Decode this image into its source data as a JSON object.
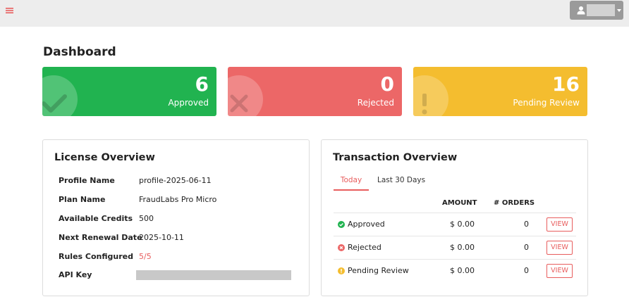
{
  "topbar": {
    "menu_icon": "hamburger-icon",
    "user_icon": "user-icon",
    "accent": "#e85d5d"
  },
  "page": {
    "title": "Dashboard"
  },
  "stats": [
    {
      "value": "6",
      "label": "Approved",
      "icon": "check-icon",
      "color": "#21b350"
    },
    {
      "value": "0",
      "label": "Rejected",
      "icon": "cross-icon",
      "color": "#ec6767"
    },
    {
      "value": "16",
      "label": "Pending Review",
      "icon": "exclamation-icon",
      "color": "#f4bd2f"
    }
  ],
  "license": {
    "title": "License Overview",
    "rows": [
      {
        "key": "Profile Name",
        "value": "profile-2025-06-11"
      },
      {
        "key": "Plan Name",
        "value": "FraudLabs Pro Micro"
      },
      {
        "key": "Available Credits",
        "value": "500"
      },
      {
        "key": "Next Renewal Date",
        "value": "2025-10-11"
      },
      {
        "key": "Rules Configured",
        "value": "5/5"
      },
      {
        "key": "API Key",
        "value": ""
      }
    ]
  },
  "transactions": {
    "title": "Transaction Overview",
    "tabs": [
      "Today",
      "Last 30 Days"
    ],
    "headers": {
      "amount": "AMOUNT",
      "orders": "# ORDERS"
    },
    "rows": [
      {
        "status": "Approved",
        "amount": "$ 0.00",
        "orders": "0",
        "action": "VIEW",
        "icon": "check-circle-icon",
        "color": "#21b350"
      },
      {
        "status": "Rejected",
        "amount": "$ 0.00",
        "orders": "0",
        "action": "VIEW",
        "icon": "x-circle-icon",
        "color": "#ec6767"
      },
      {
        "status": "Pending Review",
        "amount": "$ 0.00",
        "orders": "0",
        "action": "VIEW",
        "icon": "exclamation-circle-icon",
        "color": "#f4bd2f"
      }
    ]
  }
}
